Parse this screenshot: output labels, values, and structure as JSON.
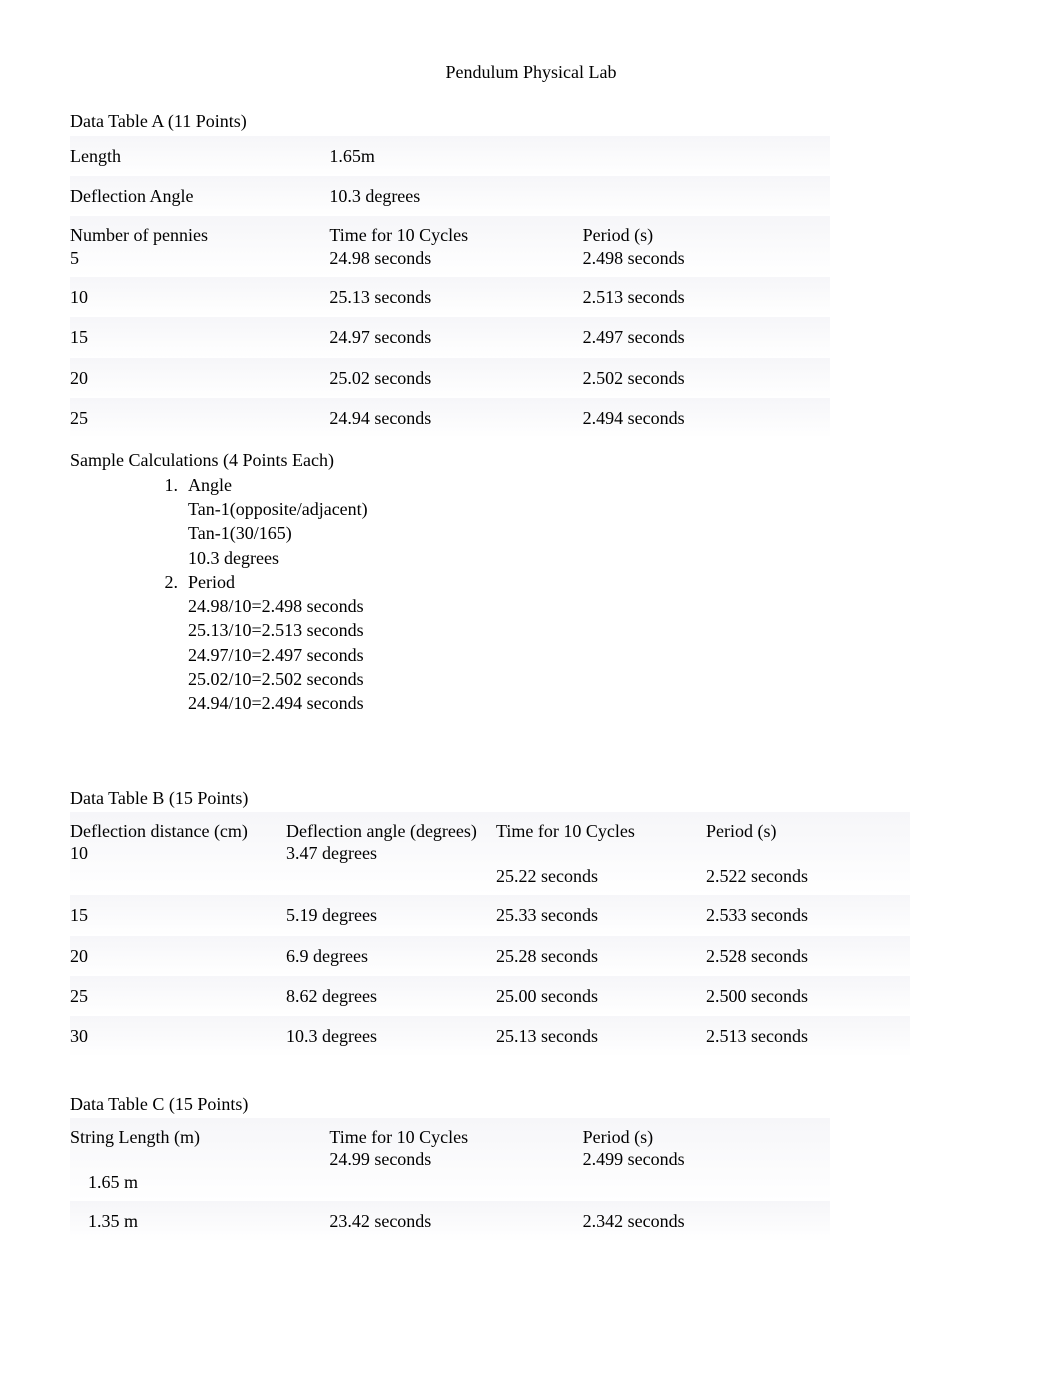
{
  "title": "Pendulum Physical Lab",
  "tableA": {
    "label": "Data Table A (11 Points)",
    "length_label": "Length",
    "length_value": "1.65m",
    "angle_label": "Deflection Angle",
    "angle_value": "10.3 degrees",
    "headers": {
      "pennies": "Number of pennies",
      "time": "Time for 10 Cycles",
      "period": "Period (s)"
    },
    "rows": [
      {
        "pennies": "5",
        "time": "24.98 seconds",
        "period": "2.498 seconds"
      },
      {
        "pennies": "10",
        "time": "25.13 seconds",
        "period": "2.513 seconds"
      },
      {
        "pennies": "15",
        "time": "24.97 seconds",
        "period": "2.497 seconds"
      },
      {
        "pennies": "20",
        "time": "25.02 seconds",
        "period": "2.502 seconds"
      },
      {
        "pennies": "25",
        "time": "24.94 seconds",
        "period": "2.494 seconds"
      }
    ]
  },
  "calculations": {
    "label": "Sample Calculations (4 Points Each)",
    "items": [
      {
        "num": "1.",
        "title": "Angle",
        "lines": [
          "Tan-1(opposite/adjacent)",
          "Tan-1(30/165)",
          "10.3 degrees"
        ]
      },
      {
        "num": "2.",
        "title": "Period",
        "lines": [
          "24.98/10=2.498 seconds",
          "25.13/10=2.513 seconds",
          "24.97/10=2.497 seconds",
          "25.02/10=2.502 seconds",
          "24.94/10=2.494 seconds"
        ]
      }
    ]
  },
  "tableB": {
    "label": "Data Table B (15 Points)",
    "headers": {
      "distance": "Deflection distance (cm)",
      "angle": "Deflection angle (degrees)",
      "time": "Time for 10 Cycles",
      "period": "Period (s)"
    },
    "rows": [
      {
        "distance": "10",
        "angle": "3.47 degrees",
        "time": "25.22 seconds",
        "period": "2.522 seconds"
      },
      {
        "distance": "15",
        "angle": "5.19 degrees",
        "time": "25.33 seconds",
        "period": "2.533 seconds"
      },
      {
        "distance": "20",
        "angle": "6.9 degrees",
        "time": "25.28 seconds",
        "period": "2.528 seconds"
      },
      {
        "distance": "25",
        "angle": "8.62 degrees",
        "time": "25.00 seconds",
        "period": "2.500 seconds"
      },
      {
        "distance": "30",
        "angle": "10.3 degrees",
        "time": "25.13 seconds",
        "period": "2.513 seconds"
      }
    ]
  },
  "tableC": {
    "label": "Data Table C (15 Points)",
    "headers": {
      "length": "String Length (m)",
      "time": "Time for 10 Cycles",
      "period": "Period (s)"
    },
    "rows": [
      {
        "length": "1.65 m",
        "time": "24.99 seconds",
        "period": "2.499 seconds"
      },
      {
        "length": "1.35 m",
        "time": "23.42 seconds",
        "period": "2.342 seconds"
      }
    ]
  }
}
